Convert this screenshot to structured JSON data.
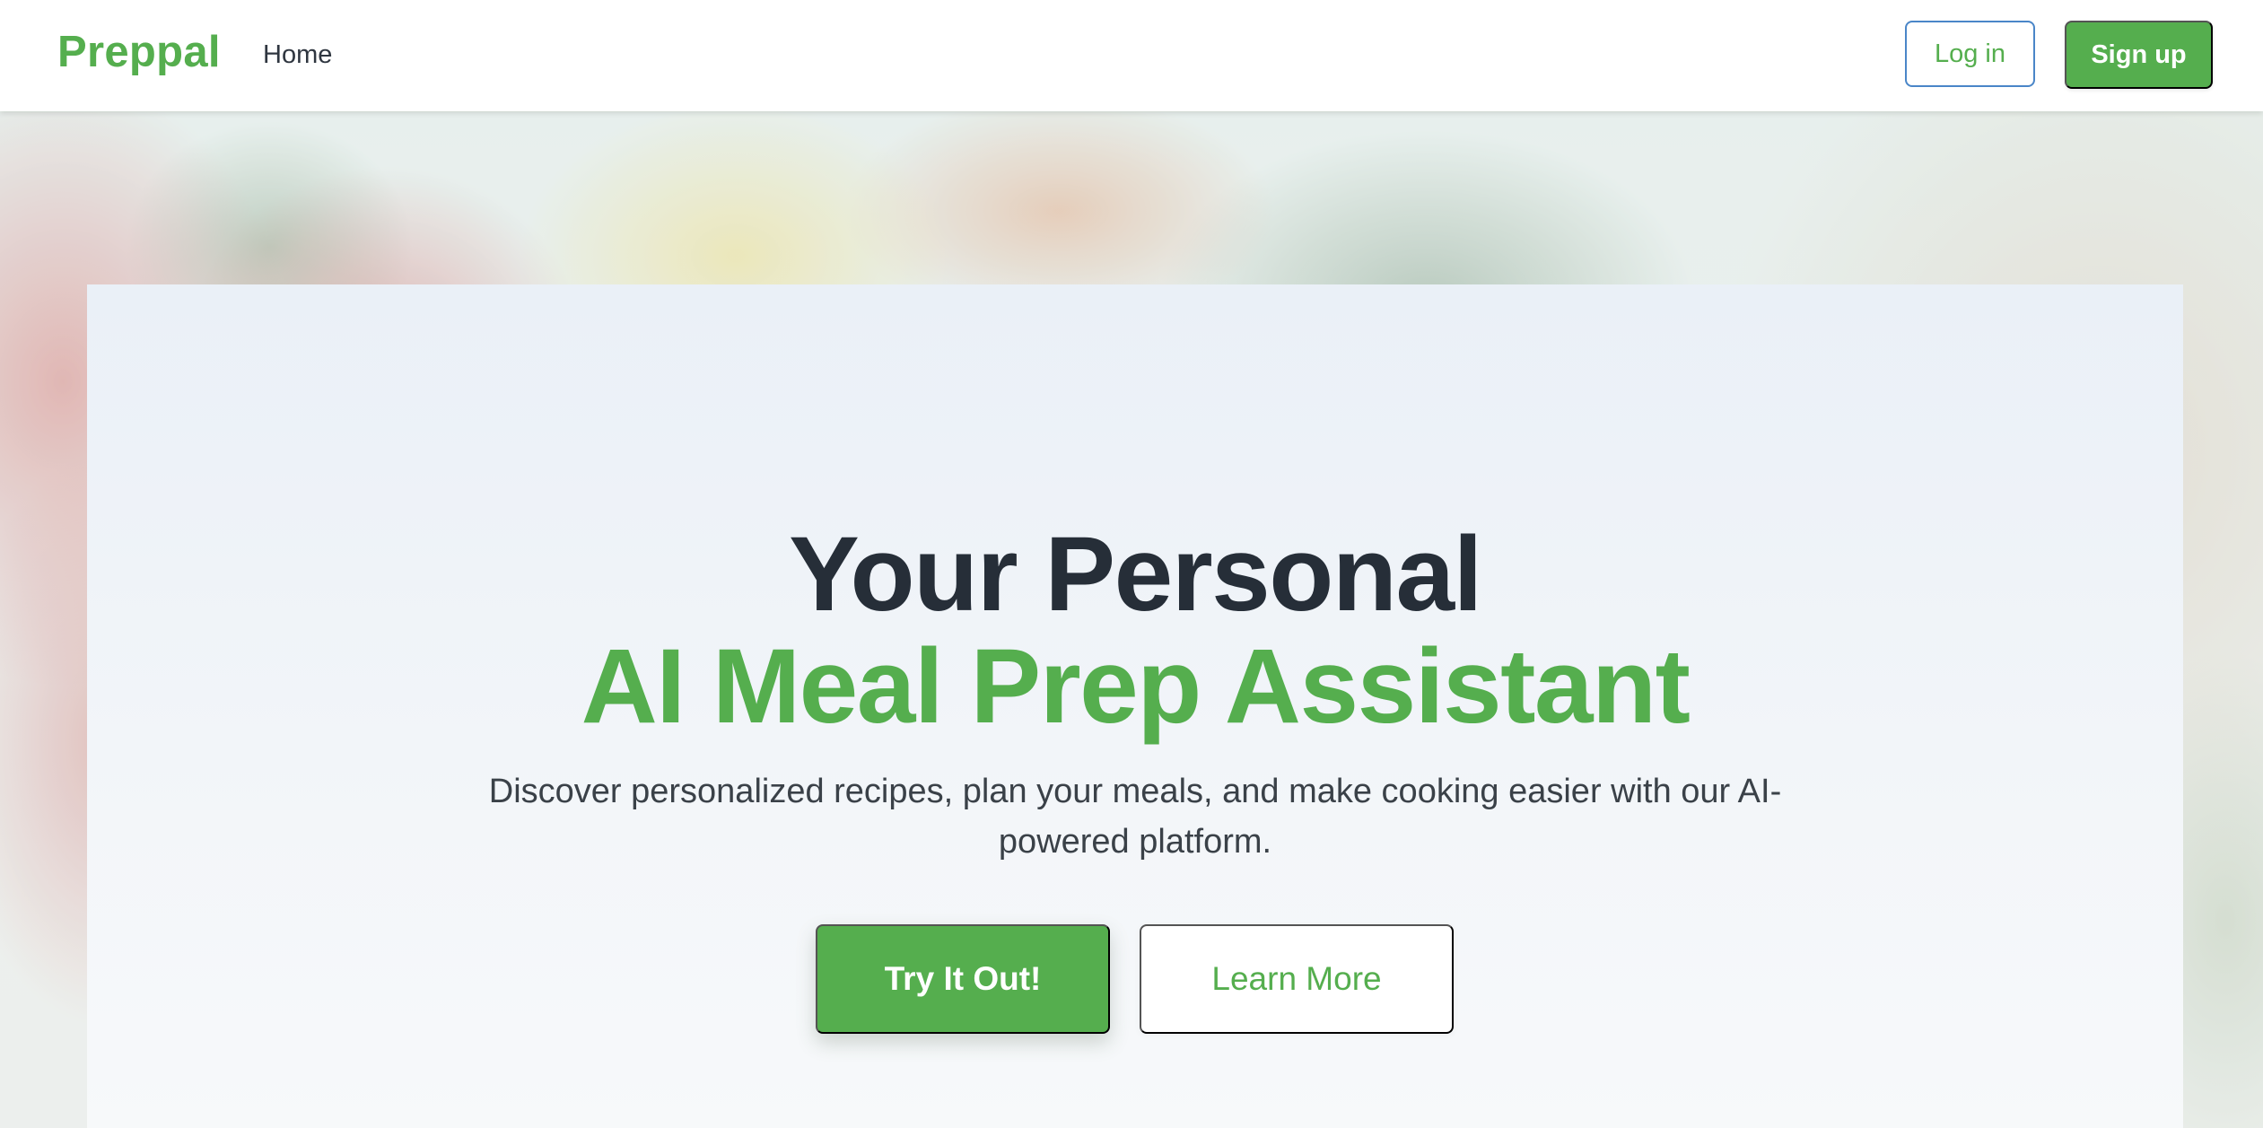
{
  "header": {
    "brand": "Preppal",
    "nav": {
      "home": "Home"
    },
    "auth": {
      "login_label": "Log in",
      "signup_label": "Sign up"
    }
  },
  "hero": {
    "title_line1": "Your Personal",
    "title_line2": "AI Meal Prep Assistant",
    "subtitle": "Discover personalized recipes, plan your meals, and make cooking easier with our AI-powered platform.",
    "primary_cta": "Try It Out!",
    "secondary_cta": "Learn More"
  },
  "colors": {
    "brand_green": "#55ae4e",
    "heading_dark": "#262e38",
    "login_border": "#4a86c8"
  }
}
